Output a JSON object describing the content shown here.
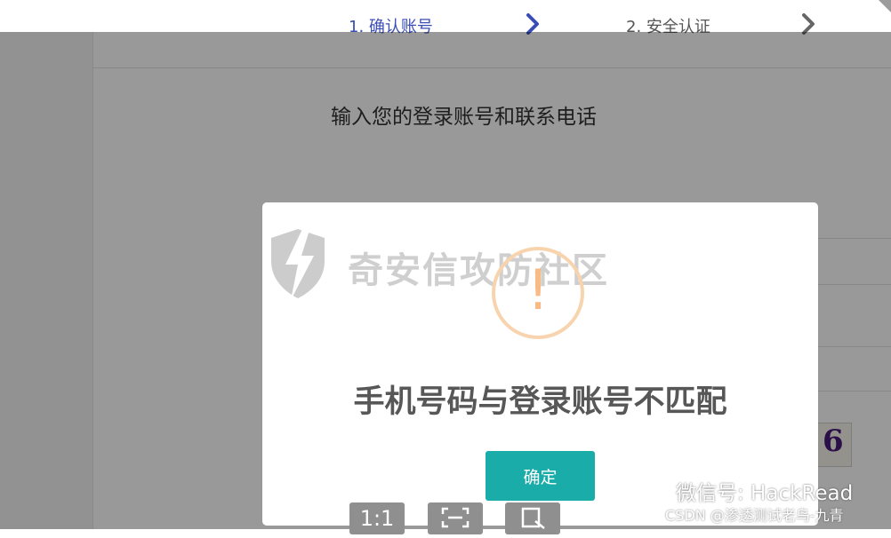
{
  "steps": [
    {
      "label": "1. 确认账号",
      "active": true
    },
    {
      "label": "2. 安全认证",
      "active": false
    }
  ],
  "form": {
    "title": "输入您的登录账号和联系电话",
    "captcha_glyph": "6"
  },
  "dialog": {
    "watermark": "奇安信攻防社区",
    "warning_glyph": "!",
    "message": "手机号码与登录账号不匹配",
    "confirm_label": "确定"
  },
  "viewer_toolbar": {
    "actual_size_label": "1:1",
    "icons": [
      "fit-screen-icon",
      "crop-icon"
    ]
  },
  "overlay_text": {
    "wechat": "微信号: HackRead",
    "csdn": "CSDN @渗透测试老鸟-九青"
  },
  "colors": {
    "active_step": "#3a4db5",
    "confirm_button": "#1aaca8",
    "warning": "#f8bb86"
  }
}
